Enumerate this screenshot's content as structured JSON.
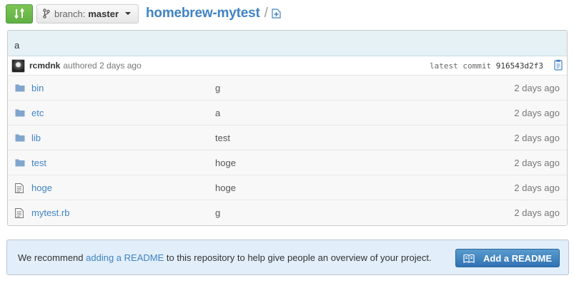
{
  "header": {
    "branch_label": "branch:",
    "branch_name": "master",
    "repo_name": "homebrew-mytest",
    "separator": "/"
  },
  "commit": {
    "message": "a",
    "author": "rcmdnk",
    "authored_text": "authored 2 days ago",
    "latest_label": "latest commit",
    "sha": "916543d2f3"
  },
  "files": [
    {
      "type": "folder",
      "name": "bin",
      "message": "g",
      "age": "2 days ago"
    },
    {
      "type": "folder",
      "name": "etc",
      "message": "a",
      "age": "2 days ago"
    },
    {
      "type": "folder",
      "name": "lib",
      "message": "test",
      "age": "2 days ago"
    },
    {
      "type": "folder",
      "name": "test",
      "message": "hoge",
      "age": "2 days ago"
    },
    {
      "type": "file",
      "name": "hoge",
      "message": "hoge",
      "age": "2 days ago"
    },
    {
      "type": "file",
      "name": "mytest.rb",
      "message": "g",
      "age": "2 days ago"
    }
  ],
  "readme": {
    "text_before": "We recommend ",
    "link": "adding a README",
    "text_after": " to this repository to help give people an overview of your project.",
    "button_label": "Add a README"
  },
  "colors": {
    "link": "#4183c4",
    "compare_green": "#6cc644",
    "readme_button": "#3b7fc1",
    "folder_icon": "#80a6cd"
  }
}
